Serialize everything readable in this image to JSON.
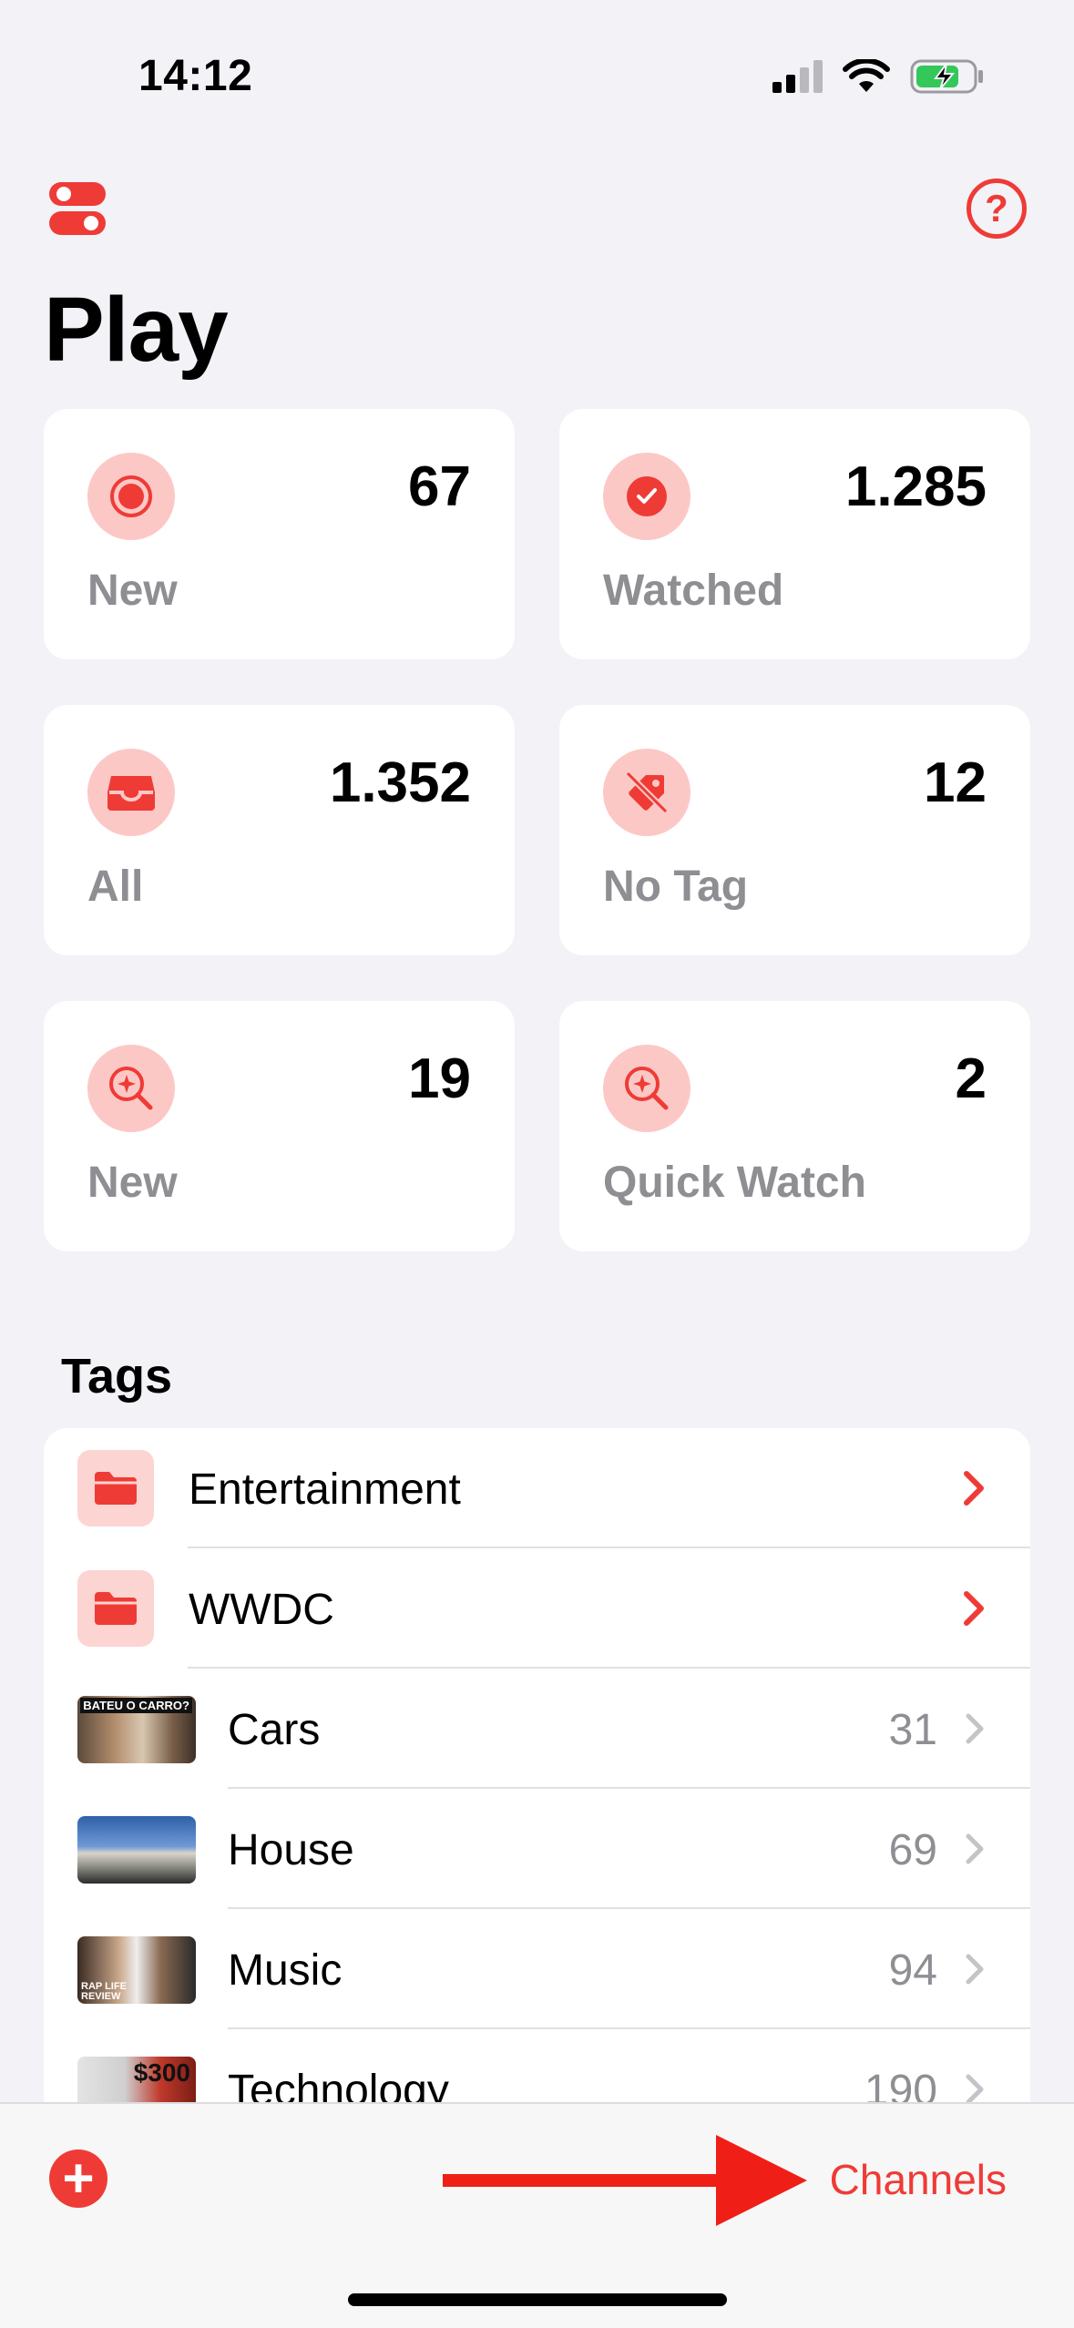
{
  "status_bar": {
    "time": "14:12"
  },
  "header": {
    "title": "Play"
  },
  "cards": [
    {
      "label": "New",
      "count": "67",
      "icon": "record-icon"
    },
    {
      "label": "Watched",
      "count": "1.285",
      "icon": "checkmark-circle-icon"
    },
    {
      "label": "All",
      "count": "1.352",
      "icon": "tray-icon"
    },
    {
      "label": "No Tag",
      "count": "12",
      "icon": "tag-slash-icon"
    },
    {
      "label": "New",
      "count": "19",
      "icon": "magnifier-sparkle-icon"
    },
    {
      "label": "Quick Watch",
      "count": "2",
      "icon": "magnifier-sparkle-icon"
    }
  ],
  "tags": {
    "title": "Tags",
    "folders": [
      {
        "name": "Entertainment"
      },
      {
        "name": "WWDC"
      }
    ],
    "items": [
      {
        "name": "Cars",
        "count": "31",
        "thumb_text": "BATEU O CARRO?"
      },
      {
        "name": "House",
        "count": "69"
      },
      {
        "name": "Music",
        "count": "94",
        "thumb_text": "RAP LIFE REVIEW"
      },
      {
        "name": "Technology",
        "count": "190",
        "thumb_text": "$300"
      }
    ]
  },
  "bottom_bar": {
    "channels_label": "Channels"
  },
  "colors": {
    "accent": "#ef3b36",
    "accent_light": "#fcc8c5",
    "background": "#f2f2f7"
  }
}
